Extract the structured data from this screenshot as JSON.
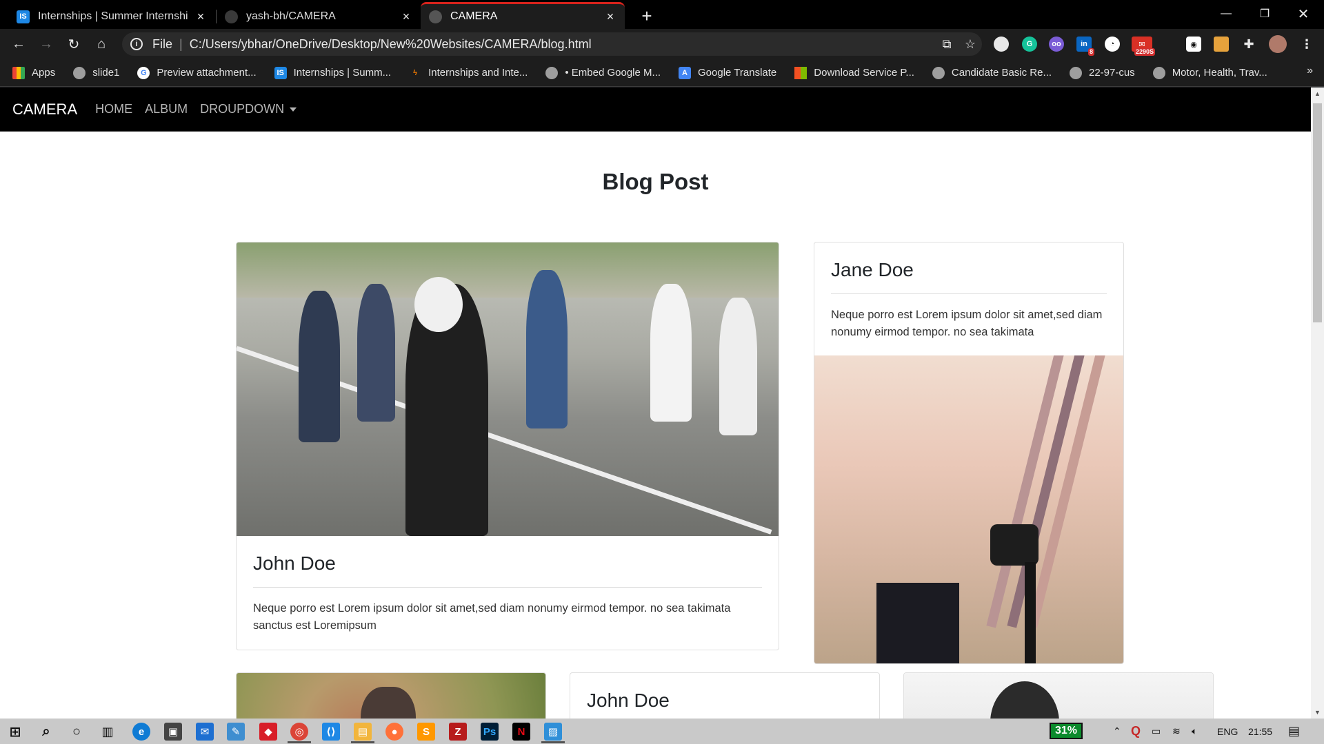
{
  "browser": {
    "tabs": [
      {
        "title": "Internships | Summer Internship",
        "favicon": "IS",
        "favicon_color": "#1e88e5"
      },
      {
        "title": "yash-bh/CAMERA",
        "favicon": "",
        "favicon_color": "#444444"
      },
      {
        "title": "CAMERA",
        "favicon": "",
        "favicon_color": "#555555"
      }
    ],
    "address": {
      "scheme": "File",
      "url": "C:/Users/ybhar/OneDrive/Desktop/New%20Websites/CAMERA/blog.html"
    },
    "extensions": [
      {
        "name": "record-icon",
        "color": "#e8e8e8"
      },
      {
        "name": "grammarly-icon",
        "color": "#15c39a"
      },
      {
        "name": "glasses-icon",
        "color": "#7b5cd6"
      },
      {
        "name": "linkedin-icon",
        "color": "#0a66c2",
        "badge": "8"
      },
      {
        "name": "speed-icon",
        "color": "#ffffff"
      },
      {
        "name": "mail-icon",
        "color": "#d93025",
        "badge": "2290S"
      },
      {
        "name": "camera-icon",
        "color": "#ffffff"
      },
      {
        "name": "colorful-icon",
        "color": "#e6a23c"
      },
      {
        "name": "puzzle-icon",
        "color": "#e8e8e8"
      }
    ],
    "bookmarks": [
      {
        "label": "Apps",
        "icon": "apps-grid-icon",
        "color": "#ea4335"
      },
      {
        "label": "slide1",
        "icon": "globe-icon",
        "color": "#9e9e9e"
      },
      {
        "label": "Preview attachment...",
        "icon": "google-icon",
        "color": "#ffffff"
      },
      {
        "label": "Internships | Summ...",
        "icon": "internshala-icon",
        "color": "#1e88e5"
      },
      {
        "label": "Internships and Inte...",
        "icon": "flame-icon",
        "color": "#f57c00"
      },
      {
        "label": "• Embed Google M...",
        "icon": "globe-icon",
        "color": "#9e9e9e"
      },
      {
        "label": "Google Translate",
        "icon": "translate-icon",
        "color": "#4285f4"
      },
      {
        "label": "Download Service P...",
        "icon": "microsoft-icon",
        "color": "#f25022"
      },
      {
        "label": "Candidate Basic Re...",
        "icon": "globe-icon",
        "color": "#9e9e9e"
      },
      {
        "label": "22-97-cus",
        "icon": "globe-icon",
        "color": "#9e9e9e"
      },
      {
        "label": "Motor, Health, Trav...",
        "icon": "globe-icon",
        "color": "#9e9e9e"
      }
    ]
  },
  "site": {
    "brand": "CAMERA",
    "nav": {
      "home": "HOME",
      "album": "ALBUM",
      "dropdown": "DROUPDOWN"
    },
    "page_title": "Blog Post",
    "cards": [
      {
        "name": "John Doe",
        "text": "Neque porro est Lorem ipsum dolor sit amet,sed diam nonumy eirmod tempor. no sea takimata sanctus est Loremipsum"
      },
      {
        "name": "Jane Doe",
        "text": "Neque porro est Lorem ipsum dolor sit amet,sed diam nonumy eirmod tempor. no sea takimata"
      },
      {
        "name": "John Doe"
      }
    ]
  },
  "taskbar": {
    "battery": "31%",
    "language": "ENG",
    "time": "21:55"
  },
  "colors": {
    "accent_tab": "#d9231c",
    "navbar_bg": "#000000",
    "battery_green": "#0b8a2c"
  }
}
